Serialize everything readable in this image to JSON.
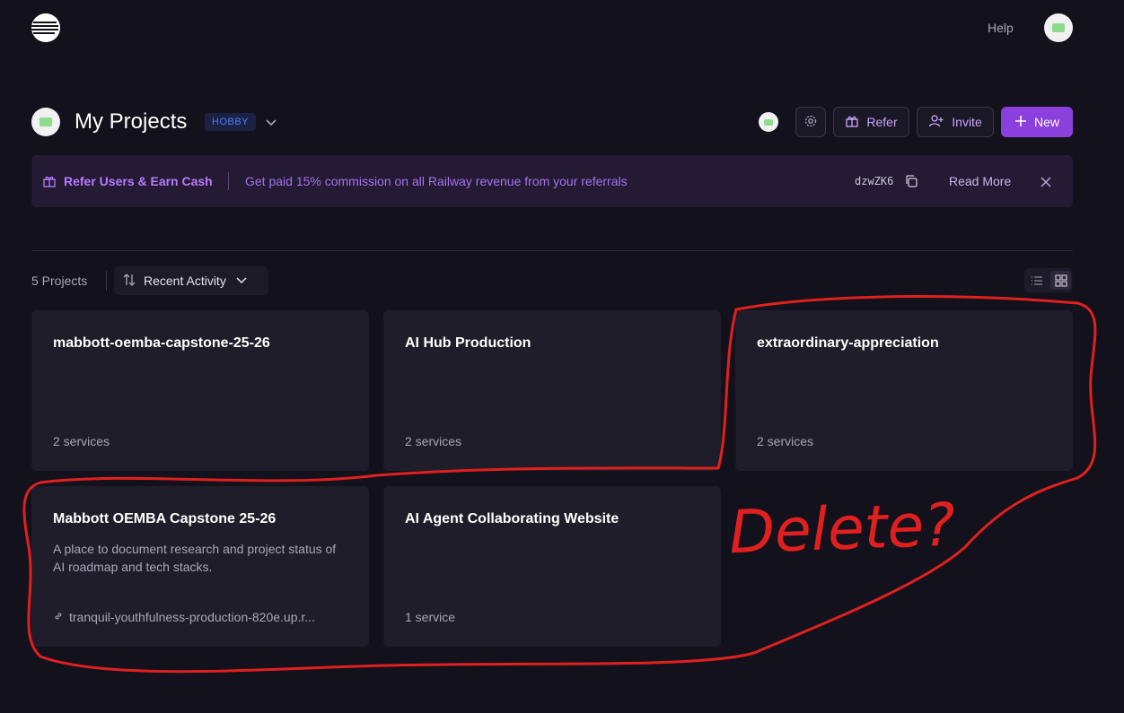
{
  "nav": {
    "help_label": "Help",
    "logo_icon": "railway-logo-icon",
    "avatar_icon": "user-avatar-icon"
  },
  "header": {
    "title": "My Projects",
    "plan_badge": "HOBBY",
    "buttons": {
      "refer": "Refer",
      "invite": "Invite",
      "new": "New"
    }
  },
  "banner": {
    "title": "Refer Users & Earn Cash",
    "text": "Get paid 15% commission on all Railway revenue from your referrals",
    "code": "dzwZK6",
    "read_more": "Read More"
  },
  "toolbar": {
    "count": "5 Projects",
    "sort_label": "Recent Activity",
    "view": "grid"
  },
  "projects": [
    {
      "title": "mabbott-oemba-capstone-25-26",
      "description": "",
      "footer": "2 services",
      "footer_is_link": false
    },
    {
      "title": "AI Hub Production",
      "description": "",
      "footer": "2 services",
      "footer_is_link": false
    },
    {
      "title": "extraordinary-appreciation",
      "description": "",
      "footer": "2 services",
      "footer_is_link": false
    },
    {
      "title": "Mabbott OEMBA Capstone 25-26",
      "description": "A place to document research and project status of AI roadmap and tech stacks.",
      "footer": "tranquil-youthfulness-production-820e.up.r...",
      "footer_is_link": true
    },
    {
      "title": "AI Agent Collaborating Website",
      "description": "",
      "footer": "1 service",
      "footer_is_link": false
    }
  ],
  "annotation": {
    "text": "Delete?",
    "color": "#e0201e"
  },
  "colors": {
    "accent": "#8b3fdc",
    "background": "#13111c",
    "card": "#1f1d29",
    "badge": "#4e7bff"
  }
}
